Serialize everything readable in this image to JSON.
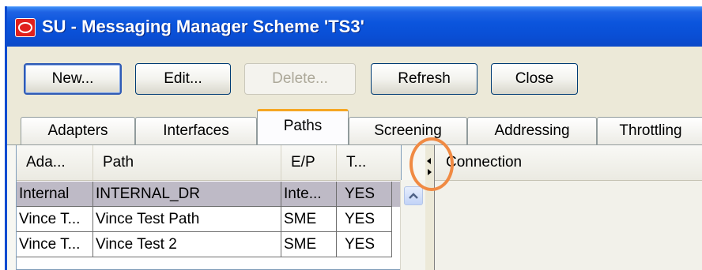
{
  "window": {
    "title": "SU - Messaging Manager Scheme 'TS3'"
  },
  "toolbar": {
    "new_label": "New...",
    "edit_label": "Edit...",
    "delete_label": "Delete...",
    "refresh_label": "Refresh",
    "close_label": "Close"
  },
  "tabs": [
    {
      "label": "Adapters"
    },
    {
      "label": "Interfaces"
    },
    {
      "label": "Paths",
      "active": true
    },
    {
      "label": "Screening"
    },
    {
      "label": "Addressing"
    },
    {
      "label": "Throttling"
    }
  ],
  "paths_table": {
    "columns": [
      "Ada...",
      "Path",
      "E/P",
      "T..."
    ],
    "rows": [
      {
        "adapter": "Internal",
        "path": "INTERNAL_DR",
        "ep": "Inte...",
        "t": "YES",
        "selected": true
      },
      {
        "adapter": "Vince T...",
        "path": "Vince Test Path",
        "ep": "SME",
        "t": "YES"
      },
      {
        "adapter": "Vince T...",
        "path": "Vince Test 2",
        "ep": "SME",
        "t": "YES"
      }
    ]
  },
  "connection_table": {
    "columns": [
      "Connection"
    ]
  },
  "colors": {
    "titlebar": "#0a4fd6",
    "active_tab_accent": "#f5a623",
    "selected_row": "#bebac6",
    "highlight_circle": "#f08a43"
  }
}
